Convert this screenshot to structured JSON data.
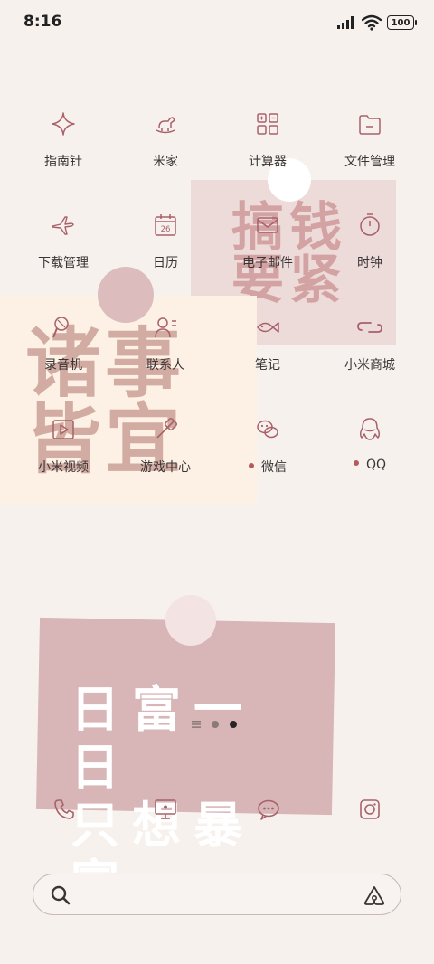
{
  "status_bar": {
    "time": "8:16",
    "battery": "100"
  },
  "apps": [
    {
      "label": "指南针",
      "icon": "compass-sparkle-icon",
      "notify": false
    },
    {
      "label": "米家",
      "icon": "rocking-horse-icon",
      "notify": false
    },
    {
      "label": "计算器",
      "icon": "calculator-grid-icon",
      "notify": false
    },
    {
      "label": "文件管理",
      "icon": "folder-icon",
      "notify": false
    },
    {
      "label": "下载管理",
      "icon": "airplane-icon",
      "notify": false
    },
    {
      "label": "日历",
      "icon": "calendar-icon",
      "calendar_day": "26",
      "notify": false
    },
    {
      "label": "电子邮件",
      "icon": "envelope-icon",
      "notify": false
    },
    {
      "label": "时钟",
      "icon": "stopwatch-icon",
      "notify": false
    },
    {
      "label": "录音机",
      "icon": "microphone-icon",
      "notify": false
    },
    {
      "label": "联系人",
      "icon": "contact-card-icon",
      "notify": false
    },
    {
      "label": "笔记",
      "icon": "fish-icon",
      "notify": false
    },
    {
      "label": "小米商城",
      "icon": "link-loop-icon",
      "notify": false
    },
    {
      "label": "小米视频",
      "icon": "video-play-icon",
      "notify": false
    },
    {
      "label": "游戏中心",
      "icon": "gamepad-icon",
      "notify": false
    },
    {
      "label": "微信",
      "icon": "wechat-bubbles-icon",
      "notify": true
    },
    {
      "label": "QQ",
      "icon": "qq-penguin-icon",
      "notify": true
    }
  ],
  "widgets": {
    "note_pink_text": "搞钱要紧",
    "note_cream_text": "诸事皆宜",
    "note_big_line1": "日富一日",
    "note_big_line2": "只想暴富"
  },
  "page_indicator": {
    "total": 3,
    "active": 2
  },
  "dock": [
    "phone-icon",
    "monitor-icon",
    "chat-bubble-icon",
    "camera-icon"
  ],
  "search": {
    "placeholder": "",
    "value": ""
  },
  "colors": {
    "accent": "#b45a5f",
    "icon_stroke": "#a8616a",
    "background": "#f7f1ee"
  }
}
